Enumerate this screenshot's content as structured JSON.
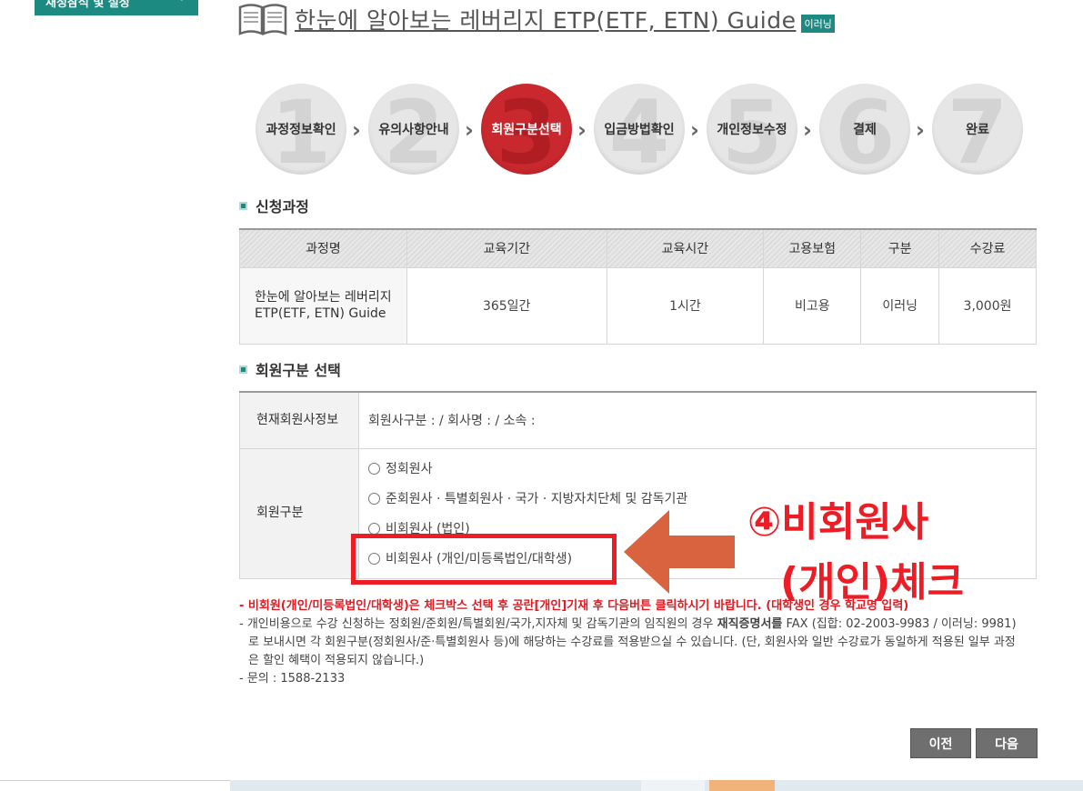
{
  "sidebar": {
    "button_label": "재정참석 및 설정",
    "chevron": "›"
  },
  "header": {
    "title": "한눈에 알아보는 레버리지 ETP(ETF, ETN) Guide",
    "badge": "이러닝"
  },
  "steps": [
    {
      "num": "1",
      "label": "과정정보확인"
    },
    {
      "num": "2",
      "label": "유의사항안내"
    },
    {
      "num": "3",
      "label": "회원구분선택"
    },
    {
      "num": "4",
      "label": "입금방법확인"
    },
    {
      "num": "5",
      "label": "개인정보수정"
    },
    {
      "num": "6",
      "label": "결제"
    },
    {
      "num": "7",
      "label": "완료"
    }
  ],
  "active_step": 3,
  "course_section": {
    "heading": "신청과정",
    "columns": [
      "과정명",
      "교육기간",
      "교육시간",
      "고용보험",
      "구분",
      "수강료"
    ],
    "row": {
      "name": "한눈에 알아보는 레버리지 ETP(ETF, ETN) Guide",
      "period": "365일간",
      "hours": "1시간",
      "insurance": "비고용",
      "type": "이러닝",
      "fee": "3,000원"
    }
  },
  "member_section": {
    "heading": "회원구분 선택",
    "current_info_label": "현재회원사정보",
    "current_info_value": "회원사구분 : / 회사명 : / 소속 :",
    "type_label": "회원구분",
    "options": [
      "정회원사",
      "준회원사 · 특별회원사 · 국가 · 지방자치단체 및 감독기관",
      "비회원사 (법인)",
      "비회원사 (개인/미등록법인/대학생)"
    ]
  },
  "annotation": {
    "line1": "④비회원사",
    "line2": "(개인)체크",
    "color": "#ee1c24"
  },
  "notes": {
    "warning": "- 비회원(개인/미등록법인/대학생)은 체크박스 선택 후 공란[개인]기재 후 다음버튼 클릭하시기 바랍니다. (대학생인 경우 학교명 입력)",
    "info_pre": "- 개인비용으로 수강 신청하는 정회원/준회원/특별회원/국가,지자체 및 감독기관의 임직원의 경우 ",
    "info_bold": "재직증명서를",
    "info_post": " FAX (집합: 02-2003-9983 / 이러닝: 9981)로 보내시면 각 회원구분(정회원사/준·특별회원사 등)에 해당하는 수강료를 적용받으실 수 있습니다. (단, 회원사와 일반 수강료가 동일하게 적용된 일부 과정은 할인 혜택이 적용되지 않습니다.)",
    "contact": "- 문의 : 1588-2133"
  },
  "buttons": {
    "prev": "이전",
    "next": "다음"
  },
  "colors": {
    "accent": "#1d8a82",
    "active_step": "#c8282e",
    "warning": "#e21a22",
    "button": "#6f6f6f"
  }
}
